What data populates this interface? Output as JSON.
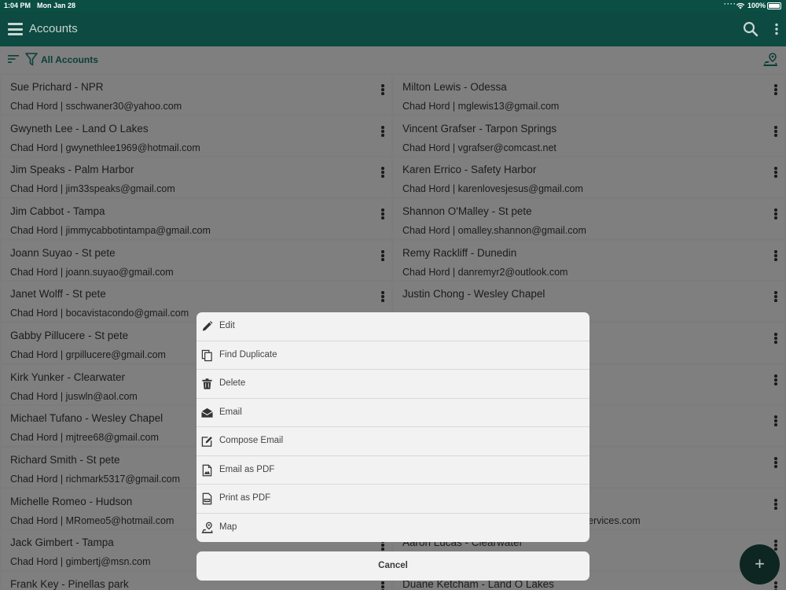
{
  "status_bar": {
    "time": "1:04 PM",
    "date": "Mon Jan 28",
    "battery": "100%"
  },
  "app_bar": {
    "title": "Accounts",
    "menu_icon": "hamburger-icon",
    "search_icon": "search-icon"
  },
  "filter_bar": {
    "label": "All Accounts"
  },
  "accounts": {
    "left": [
      {
        "name": "Sue Prichard - NPR",
        "sub": "Chad Hord | sschwaner30@yahoo.com"
      },
      {
        "name": "Gwyneth Lee - Land O Lakes",
        "sub": "Chad Hord | gwynethlee1969@hotmail.com"
      },
      {
        "name": "Jim Speaks - Palm Harbor",
        "sub": "Chad Hord | jim33speaks@gmail.com"
      },
      {
        "name": "Jim Cabbot - Tampa",
        "sub": "Chad Hord | jimmycabbotintampa@gmail.com"
      },
      {
        "name": "Joann Suyao - St pete",
        "sub": "Chad Hord | joann.suyao@gmail.com"
      },
      {
        "name": "Janet Wolff - St pete",
        "sub": "Chad Hord | bocavistacondo@gmail.com"
      },
      {
        "name": "Gabby Pillucere - St pete",
        "sub": "Chad Hord | grpillucere@gmail.com"
      },
      {
        "name": "Kirk Yunker - Clearwater",
        "sub": "Chad Hord | juswln@aol.com"
      },
      {
        "name": "Michael Tufano - Wesley Chapel",
        "sub": "Chad Hord | mjtree68@gmail.com"
      },
      {
        "name": "Richard Smith - St pete",
        "sub": "Chad Hord | richmark5317@gmail.com"
      },
      {
        "name": "Michelle Romeo - Hudson",
        "sub": "Chad Hord | MRomeo5@hotmail.com"
      },
      {
        "name": "Jack Gimbert - Tampa",
        "sub": "Chad Hord | gimbertj@msn.com"
      },
      {
        "name": "Frank Key - Pinellas park",
        "sub": ""
      }
    ],
    "right": [
      {
        "name": "Milton Lewis - Odessa",
        "sub": "Chad Hord | mglewis13@gmail.com"
      },
      {
        "name": "Vincent Grafser - Tarpon Springs",
        "sub": "Chad Hord | vgrafser@comcast.net"
      },
      {
        "name": "Karen Errico - Safety Harbor",
        "sub": "Chad Hord | karenlovesjesus@gmail.com"
      },
      {
        "name": "Shannon O'Malley - St pete",
        "sub": "Chad Hord | omalley.shannon@gmail.com"
      },
      {
        "name": "Remy Rackliff - Dunedin",
        "sub": "Chad Hord | danremyr2@outlook.com"
      },
      {
        "name": "Justin Chong - Wesley Chapel",
        "sub": ""
      },
      {
        "name": "",
        "sub": ""
      },
      {
        "name": "",
        "sub": ""
      },
      {
        "name": "",
        "sub": ""
      },
      {
        "name": "",
        "sub": ""
      },
      {
        "name": "",
        "sub": "ervices.com"
      },
      {
        "name": "Aaron Lucas - Clearwater",
        "sub": ""
      },
      {
        "name": "Duane Ketcham - Land O Lakes",
        "sub": ""
      }
    ]
  },
  "action_sheet": {
    "items": [
      {
        "label": "Edit",
        "icon": "pencil-icon"
      },
      {
        "label": "Find Duplicate",
        "icon": "copy-icon"
      },
      {
        "label": "Delete",
        "icon": "trash-icon"
      },
      {
        "label": "Email",
        "icon": "envelope-icon"
      },
      {
        "label": "Compose Email",
        "icon": "compose-icon"
      },
      {
        "label": "Email as PDF",
        "icon": "pdf-file-icon"
      },
      {
        "label": "Print as PDF",
        "icon": "pdf-print-icon"
      },
      {
        "label": "Map",
        "icon": "map-marker-icon"
      }
    ],
    "cancel_label": "Cancel"
  },
  "fab": {
    "label": "+"
  },
  "colors": {
    "header": "#0d4a41",
    "status": "#0a4e44",
    "overlay_card": "#7f7f7f",
    "sheet": "#f2f2f2"
  }
}
